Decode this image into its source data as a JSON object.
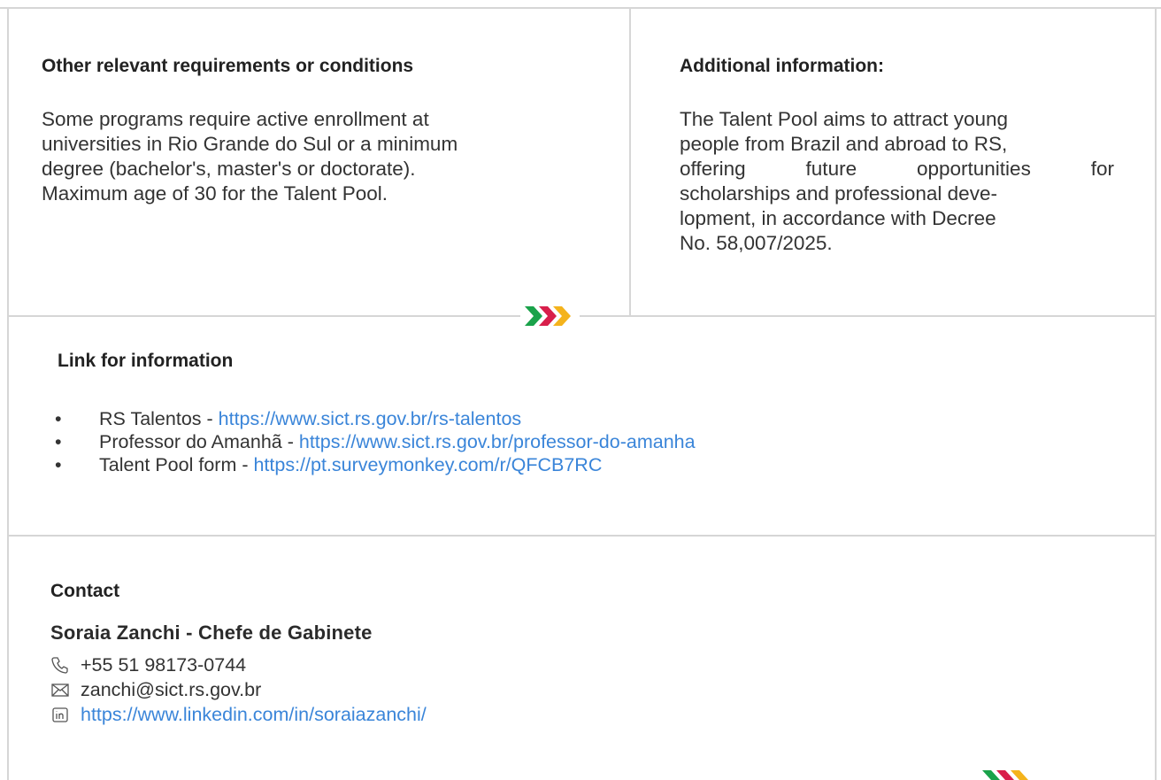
{
  "left_section": {
    "title": "Other relevant requirements or conditions",
    "lines": [
      "Some programs require active enrollment at",
      "universities in Rio Grande do Sul or a minimum",
      "degree (bachelor's, master's or doctorate).",
      "Maximum age of 30 for the Talent Pool."
    ]
  },
  "right_section": {
    "title": "Additional information:",
    "lines": [
      "The Talent Pool aims to attract young",
      "people from Brazil and abroad to RS,",
      "offering future opportunities for",
      "scholarships and professional deve-",
      "lopment, in accordance with Decree",
      "No. 58,007/2025."
    ]
  },
  "links_section": {
    "title": "Link for information",
    "bullet": "•",
    "items": [
      {
        "label": "RS Talentos - ",
        "url": "https://www.sict.rs.gov.br/rs-talentos"
      },
      {
        "label": "Professor do Amanhã - ",
        "url": "https://www.sict.rs.gov.br/professor-do-amanha"
      },
      {
        "label": "Talent Pool form - ",
        "url": "https://pt.surveymonkey.com/r/QFCB7RC"
      }
    ]
  },
  "contact_section": {
    "title": "Contact",
    "person": "Soraia Zanchi - Chefe de Gabinete",
    "phone": "+55 51 98173-0744",
    "email": "zanchi@sict.rs.gov.br",
    "linkedin": "https://www.linkedin.com/in/soraiazanchi/"
  },
  "icons": {
    "phone": "phone-icon",
    "email": "envelope-icon",
    "linkedin": "linkedin-icon",
    "divider": "triple-chevron-icon"
  },
  "colors": {
    "chevron_green": "#1aa24a",
    "chevron_red": "#d81f4b",
    "chevron_yellow": "#f4b31c",
    "link": "#3a85d9",
    "rule": "#d6d6d6"
  }
}
